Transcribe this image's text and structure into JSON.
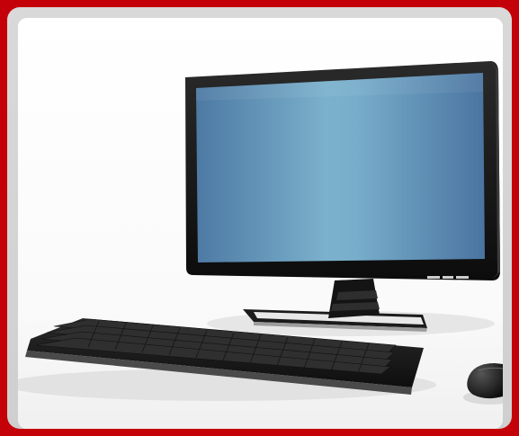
{
  "image": {
    "subject": "desktop-computer-photo",
    "frame_color": "#c40008",
    "card_color": "#d4d4d4",
    "background_color": "#ffffff",
    "screen_color": "#6aa0c0",
    "device_color": "#1a1a1a"
  }
}
